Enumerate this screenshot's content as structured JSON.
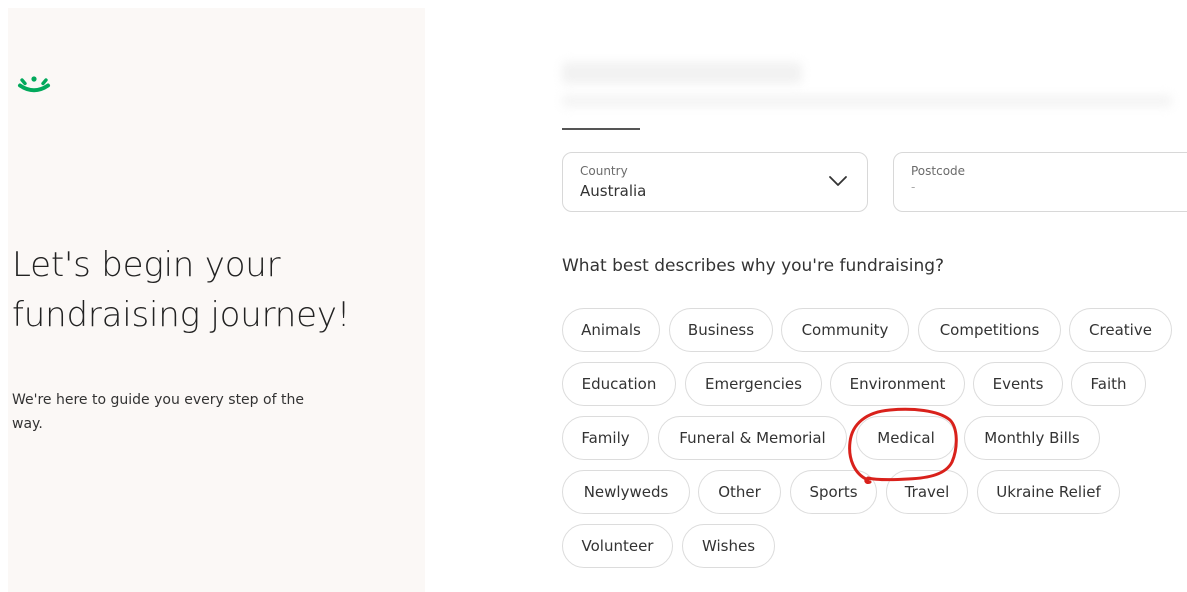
{
  "left_panel": {
    "logo_icon": "sprout-logo-icon",
    "headline_line1": "Let's begin your",
    "headline_line2": "fundraising journey!",
    "subline_line1": "We're here to guide you every step of the",
    "subline_line2": "way."
  },
  "form": {
    "country": {
      "label": "Country",
      "value": "Australia",
      "icon": "chevron-down-icon"
    },
    "postcode": {
      "label": "Postcode",
      "value": "-"
    },
    "question": "What best describes why you're fundraising?"
  },
  "categories": {
    "row1": [
      "Animals",
      "Business",
      "Community",
      "Competitions",
      "Creative"
    ],
    "row2": [
      "Education",
      "Emergencies",
      "Environment",
      "Events",
      "Faith"
    ],
    "row3": [
      "Family",
      "Funeral & Memorial",
      "Medical",
      "Monthly Bills"
    ],
    "row4": [
      "Newlyweds",
      "Other",
      "Sports",
      "Travel",
      "Ukraine Relief"
    ],
    "row5": [
      "Volunteer",
      "Wishes"
    ]
  },
  "colors": {
    "brand_green": "#02a95c",
    "annotation_red": "#d9211b",
    "left_panel_bg": "#fbf8f6"
  }
}
